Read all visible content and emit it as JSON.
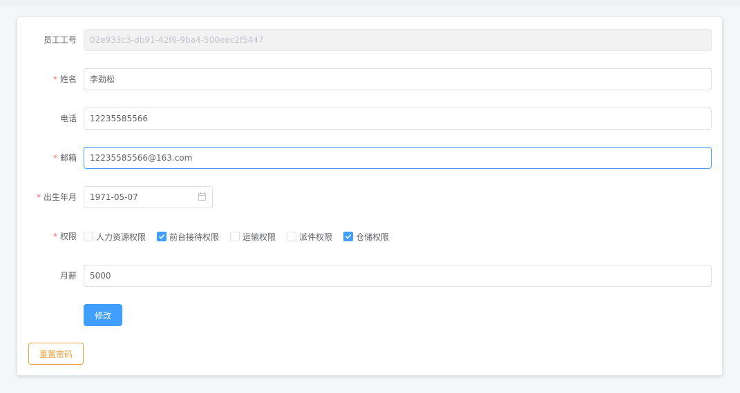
{
  "form": {
    "employee_id": {
      "label": "员工工号",
      "value": "02e933c3-db91-42f6-9ba4-500eec2f5447",
      "required": false
    },
    "name": {
      "label": "姓名",
      "value": "李劲松",
      "required": true
    },
    "phone": {
      "label": "电话",
      "value": "12235585566",
      "required": false
    },
    "email": {
      "label": "邮箱",
      "value": "12235585566@163.com",
      "required": true
    },
    "birth": {
      "label": "出生年月",
      "value": "1971-05-07",
      "required": true
    },
    "permissions": {
      "label": "权限",
      "required": true,
      "options": [
        {
          "label": "人力资源权限",
          "checked": false
        },
        {
          "label": "前台接待权限",
          "checked": true
        },
        {
          "label": "运输权限",
          "checked": false
        },
        {
          "label": "派件权限",
          "checked": false
        },
        {
          "label": "仓储权限",
          "checked": true
        }
      ]
    },
    "salary": {
      "label": "月薪",
      "value": "5000",
      "required": false
    },
    "required_mark": "*"
  },
  "buttons": {
    "submit_label": "修改",
    "reset_password_label": "重置密码"
  },
  "colors": {
    "primary": "#409eff",
    "warning": "#e6a23c",
    "required": "#f56c6c"
  },
  "icons": {
    "date": "calendar-icon",
    "checked": "checkmark-icon"
  }
}
